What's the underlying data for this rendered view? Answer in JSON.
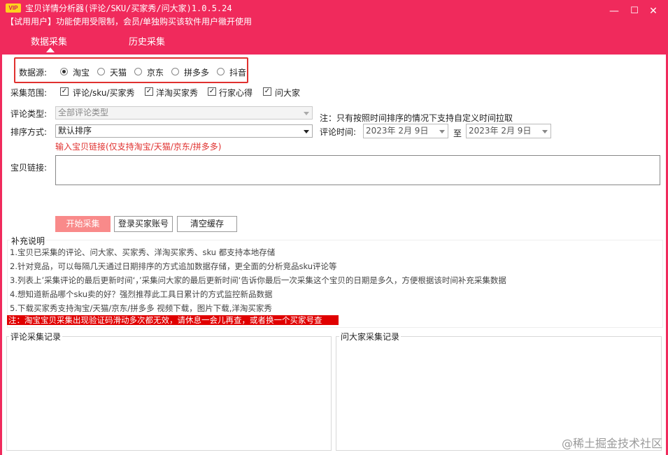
{
  "app": {
    "logo_text": "VIP",
    "title": "宝贝详情分析器(评论/SKU/买家秀/问大家)1.0.5.24",
    "trial_notice": "【试用用户】功能使用受限制，会员/单独购买该软件用户幑开使用",
    "window_controls": {
      "minimize": "—",
      "maximize": "☐",
      "close": "✕"
    }
  },
  "tabs": [
    {
      "label": "数据采集",
      "active": true
    },
    {
      "label": "历史采集",
      "active": false
    }
  ],
  "form": {
    "source_label": "数据源:",
    "sources": [
      {
        "label": "淘宝",
        "checked": true
      },
      {
        "label": "天猫",
        "checked": false
      },
      {
        "label": "京东",
        "checked": false
      },
      {
        "label": "拼多多",
        "checked": false
      },
      {
        "label": "抖音",
        "checked": false
      }
    ],
    "scope_label": "采集范围:",
    "scopes": [
      {
        "label": "评论/sku/买家秀",
        "checked": true
      },
      {
        "label": "洋淘买家秀",
        "checked": true
      },
      {
        "label": "行家心得",
        "checked": true
      },
      {
        "label": "问大家",
        "checked": true
      }
    ],
    "comment_type_label": "评论类型:",
    "comment_type_value": "全部评论类型",
    "sort_label": "排序方式:",
    "sort_value": "默认排序",
    "sort_note": "注：只有按照时间排序的情况下支持自定义时间拉取",
    "comment_time_label": "评论时间:",
    "date_from": "2023年  2月  9日",
    "date_to_label": "至",
    "date_to": "2023年  2月  9日",
    "link_hint": "输入宝贝链接(仅支持淘宝/天猫/京东/拼多多)",
    "link_label": "宝贝链接:",
    "link_value": ""
  },
  "buttons": {
    "start": "开始采集",
    "login": "登录买家账号",
    "clear": "清空缓存"
  },
  "notes": {
    "title": "补充说明",
    "items": [
      "1.宝贝已采集的评论、问大家、买家秀、洋淘买家秀、sku 都支持本地存储",
      "2.针对竞品，可以每隔几天通过日期排序的方式追加数据存储，更全面的分析竞品sku评论等",
      "3.列表上’采集评论的最后更新时间‘，’采集问大家的最后更新时间‘告诉你最后一次采集这个宝贝的日期是多久，方便根据该时间补充采集数据",
      "4.想知道新品哪个sku卖的好？强烈推荐此工具日累计的方式监控新品数据",
      "5.下载买家秀支持淘宝/天猫/京东/拼多多 视频下载，图片下载,洋淘买家秀"
    ],
    "warning": "注：淘宝宝贝采集出现验证码滑动多次都无效，请休息一会儿再查，或者换一个买家号查"
  },
  "records": {
    "comments_title": "评论采集记录",
    "qa_title": "问大家采集记录"
  },
  "watermark": "@稀土掘金技术社区"
}
